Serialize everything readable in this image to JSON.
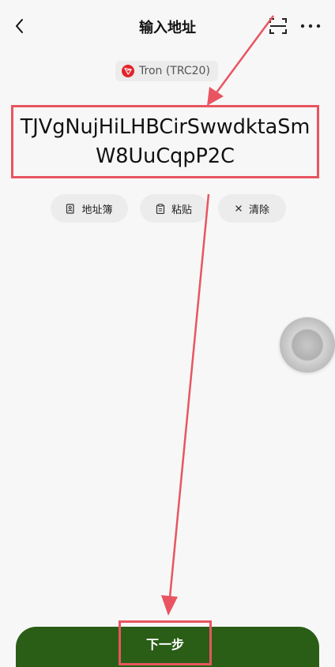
{
  "header": {
    "title": "输入地址",
    "back_icon": "chevron-left-icon",
    "scan_icon": "scan-icon",
    "more_icon": "more-horizontal-icon"
  },
  "network": {
    "label": "Tron (TRC20)",
    "icon": "tron-icon",
    "icon_color": "#e5232b"
  },
  "address": {
    "value": "TJVgNujHiLHBCirSwwdktaSmW8UuCqpP2C"
  },
  "actions": [
    {
      "label": "地址簿",
      "icon": "address-book-icon"
    },
    {
      "label": "粘贴",
      "icon": "clipboard-icon"
    },
    {
      "label": "清除",
      "icon": "close-icon"
    }
  ],
  "footer": {
    "next_label": "下一步",
    "button_color": "#2a5d16"
  },
  "annotation": {
    "highlight_color": "#e85560"
  }
}
